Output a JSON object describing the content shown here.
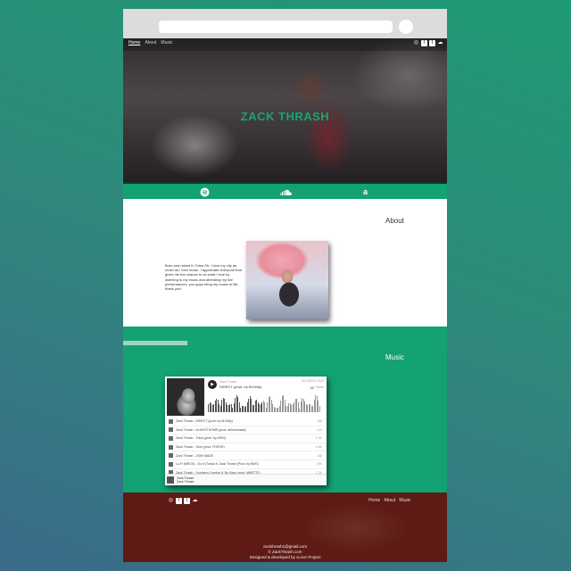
{
  "nav": {
    "home": "Home",
    "about": "About",
    "music": "Music"
  },
  "hero": {
    "title": "ZACK THRASH",
    "caption": ""
  },
  "about": {
    "heading": "About",
    "bio": "Born and raised in Tulsa Ok. I love my city as much as I love music. I appreciate everyone that gives me the chance to do what I love by listening to my music and attending my live performances. you guys bring my music to life, thank you!"
  },
  "music": {
    "heading": "Music",
    "player": {
      "artist": "Zack Thrash",
      "track": "DIRECT (prod. by M.Kelly)",
      "brand": "SOUNDCLOUD",
      "count": "42",
      "share": "Share",
      "tracks": [
        {
          "title": "Zack Thrash - DIRECT (prod. by M.Kelly)",
          "plays": "158"
        },
        {
          "title": "Zack Thrash - ALMOSTHOME (prod. ahlemonade)",
          "plays": "213"
        },
        {
          "title": "Zack Thrash - Tulsa (prod. by AEIN)",
          "plays": "1.3K"
        },
        {
          "title": "Zack Thrash - Tone (prod. FORGE)",
          "plays": "4.5K"
        },
        {
          "title": "Zack Thrash - ZION MADE",
          "plays": "146"
        },
        {
          "title": "Lo-Fi (MEDS) - Do It (Tulsa) ft. Zack Thrash (Prod. by BMS)",
          "plays": "390"
        },
        {
          "title": "Zack Thrash - Southern Comfort ft. Bo Bazz (prod. MNETTE)",
          "plays": "1.2K"
        },
        {
          "title": "Zack Thrash - Roam",
          "plays": "330"
        }
      ],
      "footer_artist": "Zack Thrash",
      "footer_title": "Zack Thrash"
    }
  },
  "footer": {
    "email": "zackthrash1@gmail.com",
    "copyright": "© ZackThrash.com",
    "credit": "Designed & developed by xLicer Project",
    "nav": {
      "home": "Home",
      "about": "About",
      "music": "Music"
    }
  },
  "icons": {
    "social": [
      "instagram-icon",
      "facebook-icon",
      "twitter-icon",
      "soundcloud-icon"
    ],
    "streaming": [
      "spotify-icon",
      "soundcloud-icon",
      "amazon-icon"
    ]
  },
  "colors": {
    "accent": "#14a173",
    "footer": "#5e1a15",
    "title": "#1aa36f"
  }
}
